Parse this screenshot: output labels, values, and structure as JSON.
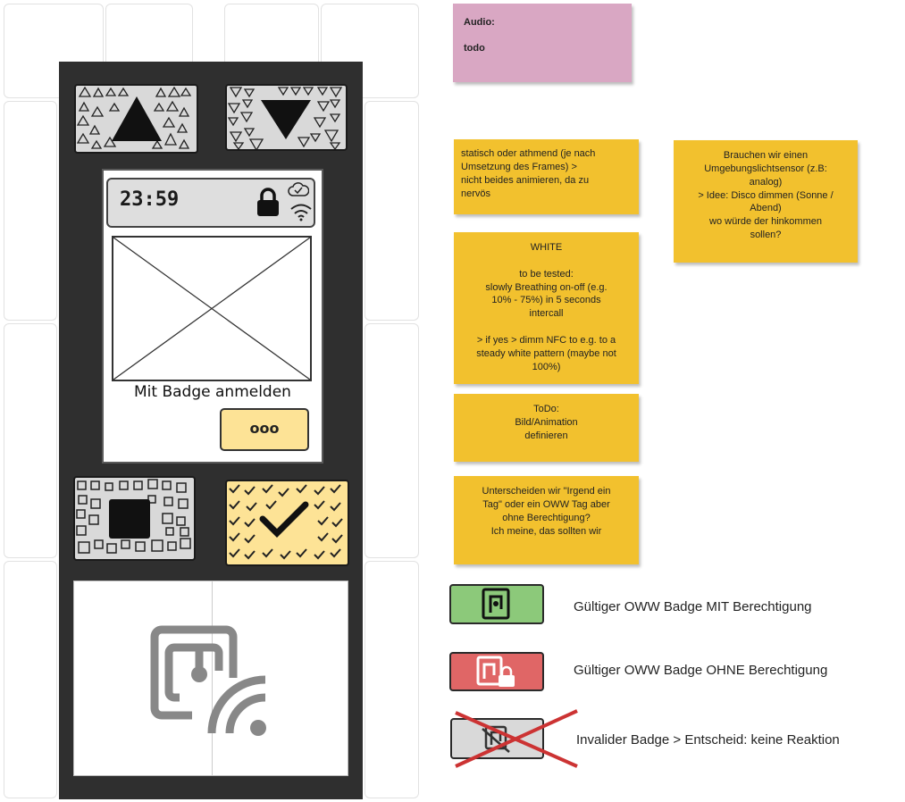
{
  "status_bar": {
    "time": "23:59"
  },
  "screen": {
    "caption": "Mit Badge anmelden",
    "more_button": "ooo"
  },
  "notes": {
    "audio_title": "Audio:",
    "audio_body": "todo",
    "animation_mode": "statisch oder athmend (je nach\nUmsetzung des Frames) >\nnicht beides animieren, da zu\nnervös",
    "light_sensor": "Brauchen wir einen\nUmgebungslichtsensor  (z.B:\nanalog)\n> Idee: Disco dimmen (Sonne /\nAbend)\nwo würde der hinkommen\nsollen?",
    "white": "WHITE\n\nto be tested:\nslowly Breathing on-off (e.g.\n10% - 75%) in 5 seconds\nintercall\n\n> if yes > dimm NFC to e.g. to a\nsteady white pattern (maybe not\n100%)",
    "todo": "ToDo:\nBild/Animation\ndefinieren",
    "distinguish": "Unterscheiden wir \"Irgend ein\nTag\" oder ein OWW Tag aber\nohne Berechtigung?\nIch meine, das sollten wir"
  },
  "legend": [
    {
      "label": "Gültiger OWW Badge MIT Berechtigung",
      "color": "#8cc97a"
    },
    {
      "label": "Gültiger OWW Badge OHNE Berechtigung",
      "color": "#e06666"
    },
    {
      "label": "Invalider Badge >  Entscheid: keine Reaktion",
      "color": "#d9d9d9"
    }
  ],
  "colors": {
    "device": "#2f2f2f",
    "sticky_orange": "#f2c12e",
    "sticky_pink": "#d9a7c3",
    "cross": "#cc3333"
  }
}
